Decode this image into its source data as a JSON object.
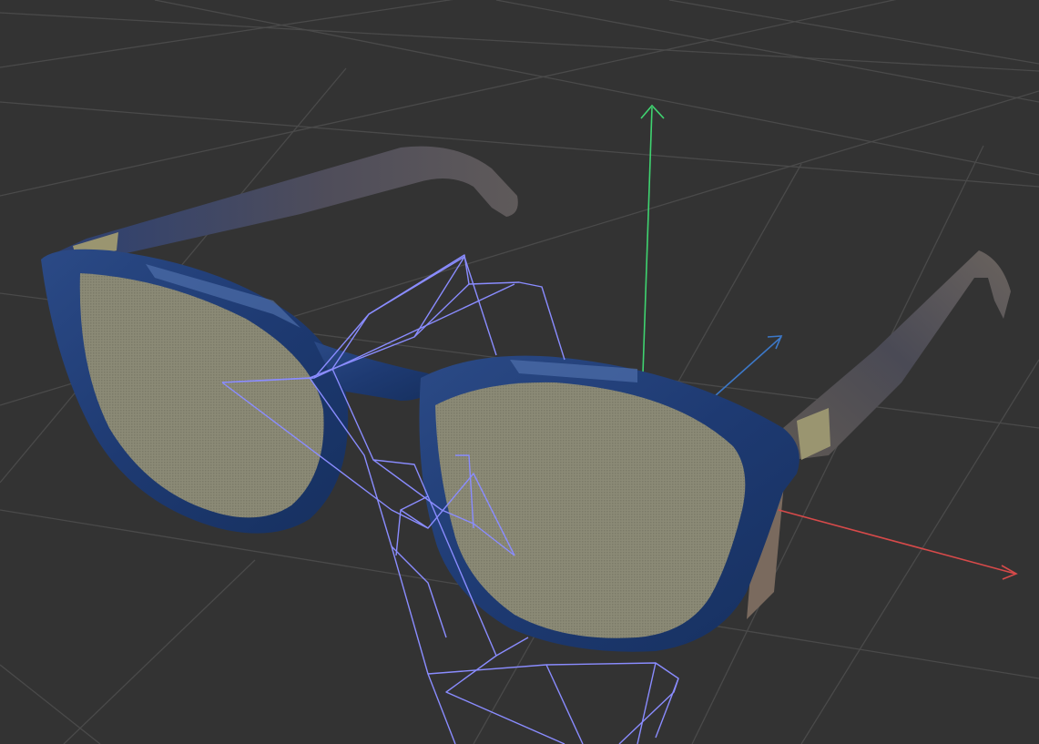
{
  "viewport": {
    "background_color": "#333333",
    "grid_color": "#4a4a4a",
    "axis_x_color": "#d74a4a",
    "axis_y_color": "#3fd370",
    "axis_z_color": "#3c78c8",
    "wireframe_color": "#8a8cff",
    "frame_color": "#1e3a72",
    "frame_highlight_color": "#5577b3",
    "lens_color": "#8b8a76",
    "temple_color": "#4f4d52",
    "hinge_color": "#9a9570"
  },
  "model": {
    "name": "glasses-model",
    "icon": "glasses-icon"
  },
  "helper": {
    "name": "head-proxy-wireframe"
  },
  "gizmo": {
    "name": "transform-gizmo",
    "axes": [
      "x-axis",
      "y-axis",
      "z-axis"
    ]
  }
}
